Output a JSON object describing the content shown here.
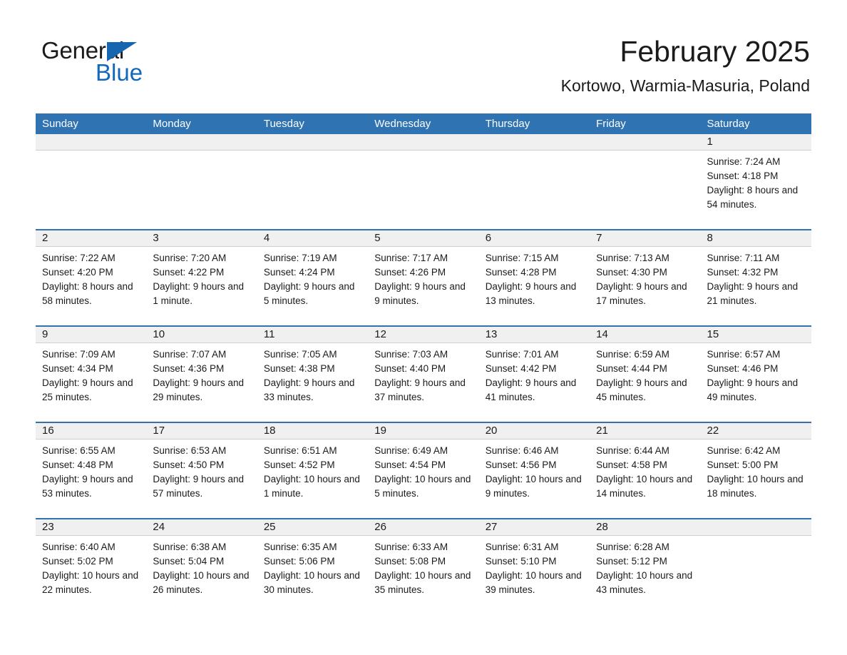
{
  "logo": {
    "word1": "General",
    "word2": "Blue",
    "triangle_color": "#1565b0",
    "word2_color": "#1268ba"
  },
  "header": {
    "title": "February 2025",
    "subtitle": "Kortowo, Warmia-Masuria, Poland"
  },
  "theme": {
    "header_bar": "#2f73b3",
    "row_rule": "#2f73b3",
    "date_band": "#f0f0f0",
    "text": "#1b1b1b"
  },
  "weekdays": [
    "Sunday",
    "Monday",
    "Tuesday",
    "Wednesday",
    "Thursday",
    "Friday",
    "Saturday"
  ],
  "weeks": [
    [
      {
        "day": "",
        "empty": true
      },
      {
        "day": "",
        "empty": true
      },
      {
        "day": "",
        "empty": true
      },
      {
        "day": "",
        "empty": true
      },
      {
        "day": "",
        "empty": true
      },
      {
        "day": "",
        "empty": true
      },
      {
        "day": "1",
        "sunrise": "Sunrise: 7:24 AM",
        "sunset": "Sunset: 4:18 PM",
        "daylight": "Daylight: 8 hours and 54 minutes."
      }
    ],
    [
      {
        "day": "2",
        "sunrise": "Sunrise: 7:22 AM",
        "sunset": "Sunset: 4:20 PM",
        "daylight": "Daylight: 8 hours and 58 minutes."
      },
      {
        "day": "3",
        "sunrise": "Sunrise: 7:20 AM",
        "sunset": "Sunset: 4:22 PM",
        "daylight": "Daylight: 9 hours and 1 minute."
      },
      {
        "day": "4",
        "sunrise": "Sunrise: 7:19 AM",
        "sunset": "Sunset: 4:24 PM",
        "daylight": "Daylight: 9 hours and 5 minutes."
      },
      {
        "day": "5",
        "sunrise": "Sunrise: 7:17 AM",
        "sunset": "Sunset: 4:26 PM",
        "daylight": "Daylight: 9 hours and 9 minutes."
      },
      {
        "day": "6",
        "sunrise": "Sunrise: 7:15 AM",
        "sunset": "Sunset: 4:28 PM",
        "daylight": "Daylight: 9 hours and 13 minutes."
      },
      {
        "day": "7",
        "sunrise": "Sunrise: 7:13 AM",
        "sunset": "Sunset: 4:30 PM",
        "daylight": "Daylight: 9 hours and 17 minutes."
      },
      {
        "day": "8",
        "sunrise": "Sunrise: 7:11 AM",
        "sunset": "Sunset: 4:32 PM",
        "daylight": "Daylight: 9 hours and 21 minutes."
      }
    ],
    [
      {
        "day": "9",
        "sunrise": "Sunrise: 7:09 AM",
        "sunset": "Sunset: 4:34 PM",
        "daylight": "Daylight: 9 hours and 25 minutes."
      },
      {
        "day": "10",
        "sunrise": "Sunrise: 7:07 AM",
        "sunset": "Sunset: 4:36 PM",
        "daylight": "Daylight: 9 hours and 29 minutes."
      },
      {
        "day": "11",
        "sunrise": "Sunrise: 7:05 AM",
        "sunset": "Sunset: 4:38 PM",
        "daylight": "Daylight: 9 hours and 33 minutes."
      },
      {
        "day": "12",
        "sunrise": "Sunrise: 7:03 AM",
        "sunset": "Sunset: 4:40 PM",
        "daylight": "Daylight: 9 hours and 37 minutes."
      },
      {
        "day": "13",
        "sunrise": "Sunrise: 7:01 AM",
        "sunset": "Sunset: 4:42 PM",
        "daylight": "Daylight: 9 hours and 41 minutes."
      },
      {
        "day": "14",
        "sunrise": "Sunrise: 6:59 AM",
        "sunset": "Sunset: 4:44 PM",
        "daylight": "Daylight: 9 hours and 45 minutes."
      },
      {
        "day": "15",
        "sunrise": "Sunrise: 6:57 AM",
        "sunset": "Sunset: 4:46 PM",
        "daylight": "Daylight: 9 hours and 49 minutes."
      }
    ],
    [
      {
        "day": "16",
        "sunrise": "Sunrise: 6:55 AM",
        "sunset": "Sunset: 4:48 PM",
        "daylight": "Daylight: 9 hours and 53 minutes."
      },
      {
        "day": "17",
        "sunrise": "Sunrise: 6:53 AM",
        "sunset": "Sunset: 4:50 PM",
        "daylight": "Daylight: 9 hours and 57 minutes."
      },
      {
        "day": "18",
        "sunrise": "Sunrise: 6:51 AM",
        "sunset": "Sunset: 4:52 PM",
        "daylight": "Daylight: 10 hours and 1 minute."
      },
      {
        "day": "19",
        "sunrise": "Sunrise: 6:49 AM",
        "sunset": "Sunset: 4:54 PM",
        "daylight": "Daylight: 10 hours and 5 minutes."
      },
      {
        "day": "20",
        "sunrise": "Sunrise: 6:46 AM",
        "sunset": "Sunset: 4:56 PM",
        "daylight": "Daylight: 10 hours and 9 minutes."
      },
      {
        "day": "21",
        "sunrise": "Sunrise: 6:44 AM",
        "sunset": "Sunset: 4:58 PM",
        "daylight": "Daylight: 10 hours and 14 minutes."
      },
      {
        "day": "22",
        "sunrise": "Sunrise: 6:42 AM",
        "sunset": "Sunset: 5:00 PM",
        "daylight": "Daylight: 10 hours and 18 minutes."
      }
    ],
    [
      {
        "day": "23",
        "sunrise": "Sunrise: 6:40 AM",
        "sunset": "Sunset: 5:02 PM",
        "daylight": "Daylight: 10 hours and 22 minutes."
      },
      {
        "day": "24",
        "sunrise": "Sunrise: 6:38 AM",
        "sunset": "Sunset: 5:04 PM",
        "daylight": "Daylight: 10 hours and 26 minutes."
      },
      {
        "day": "25",
        "sunrise": "Sunrise: 6:35 AM",
        "sunset": "Sunset: 5:06 PM",
        "daylight": "Daylight: 10 hours and 30 minutes."
      },
      {
        "day": "26",
        "sunrise": "Sunrise: 6:33 AM",
        "sunset": "Sunset: 5:08 PM",
        "daylight": "Daylight: 10 hours and 35 minutes."
      },
      {
        "day": "27",
        "sunrise": "Sunrise: 6:31 AM",
        "sunset": "Sunset: 5:10 PM",
        "daylight": "Daylight: 10 hours and 39 minutes."
      },
      {
        "day": "28",
        "sunrise": "Sunrise: 6:28 AM",
        "sunset": "Sunset: 5:12 PM",
        "daylight": "Daylight: 10 hours and 43 minutes."
      },
      {
        "day": "",
        "empty": true
      }
    ]
  ]
}
